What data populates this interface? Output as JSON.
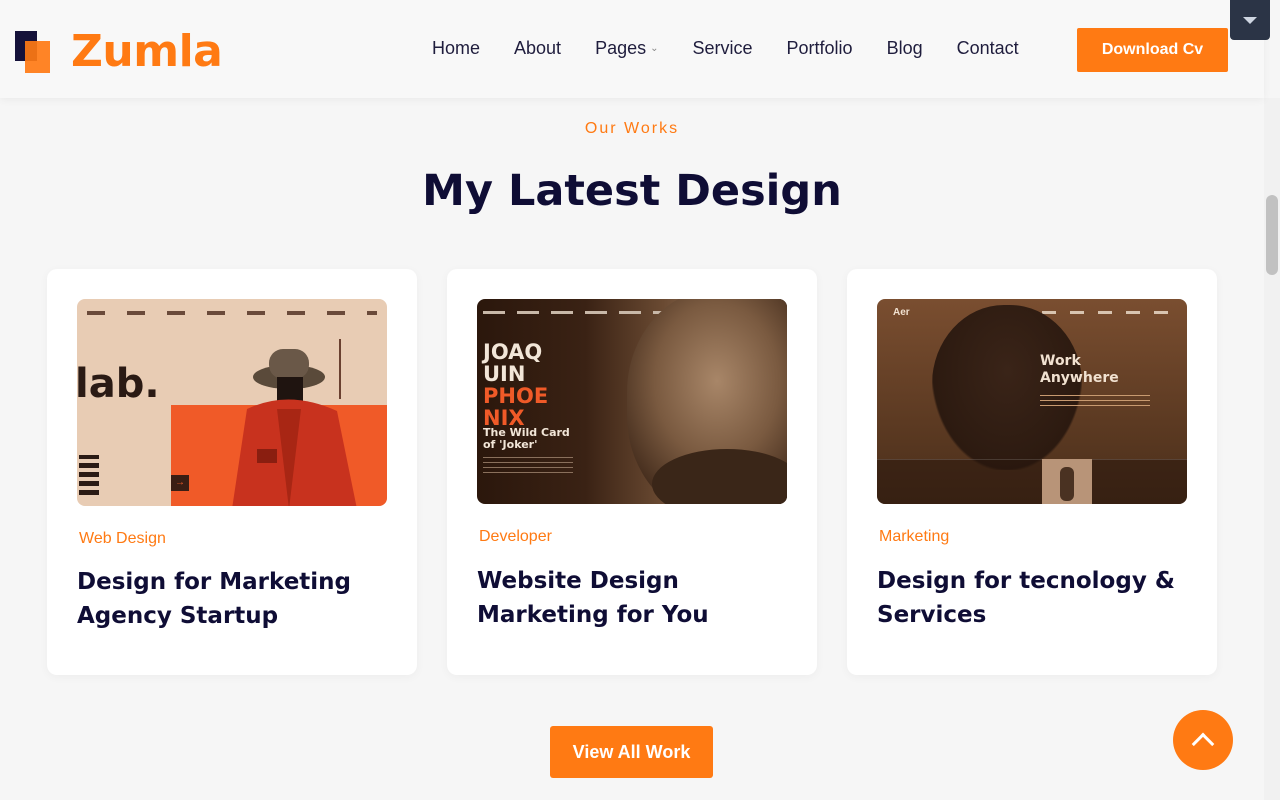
{
  "header": {
    "logo_text": "Zumla",
    "nav": [
      {
        "label": "Home"
      },
      {
        "label": "About"
      },
      {
        "label": "Pages"
      },
      {
        "label": "Service"
      },
      {
        "label": "Portfolio"
      },
      {
        "label": "Blog"
      },
      {
        "label": "Contact"
      }
    ],
    "download_label": "Download Cv"
  },
  "section": {
    "eyebrow": "Our Works",
    "title": "My Latest Design"
  },
  "cards": [
    {
      "category": "Web Design",
      "title": "Design for Marketing Agency Startup",
      "thumb": {
        "brand": "lab."
      }
    },
    {
      "category": "Developer",
      "title": "Website Design Marketing for You",
      "thumb": {
        "line1": "JOAQ",
        "line2": "UIN",
        "line3": "PHOE",
        "line4": "NIX",
        "sub1": "The Wild Card",
        "sub2": "of 'Joker'"
      }
    },
    {
      "category": "Marketing",
      "title": "Design for tecnology & Services",
      "thumb": {
        "brand": "Aer",
        "headline1": "Work",
        "headline2": "Anywhere"
      }
    }
  ],
  "view_all_label": "View All Work",
  "colors": {
    "accent": "#ff7a13",
    "heading": "#0f0d35",
    "background": "#f6f6f6"
  }
}
